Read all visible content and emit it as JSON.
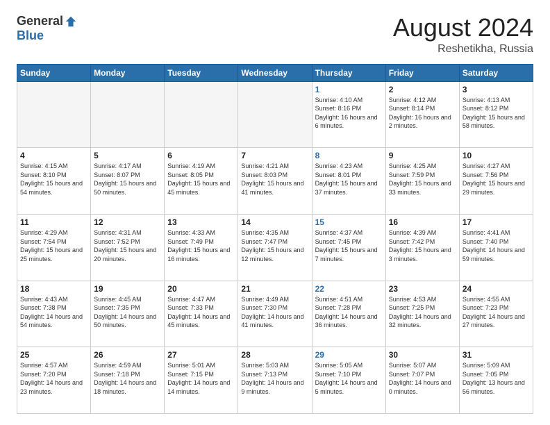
{
  "logo": {
    "general": "General",
    "blue": "Blue"
  },
  "title": "August 2024",
  "location": "Reshetikha, Russia",
  "weekdays": [
    "Sunday",
    "Monday",
    "Tuesday",
    "Wednesday",
    "Thursday",
    "Friday",
    "Saturday"
  ],
  "weeks": [
    [
      {
        "day": "",
        "empty": true
      },
      {
        "day": "",
        "empty": true
      },
      {
        "day": "",
        "empty": true
      },
      {
        "day": "",
        "empty": true
      },
      {
        "day": "1",
        "sunrise": "4:10 AM",
        "sunset": "8:16 PM",
        "daylight": "16 hours and 6 minutes."
      },
      {
        "day": "2",
        "sunrise": "4:12 AM",
        "sunset": "8:14 PM",
        "daylight": "16 hours and 2 minutes."
      },
      {
        "day": "3",
        "sunrise": "4:13 AM",
        "sunset": "8:12 PM",
        "daylight": "15 hours and 58 minutes."
      }
    ],
    [
      {
        "day": "4",
        "sunrise": "4:15 AM",
        "sunset": "8:10 PM",
        "daylight": "15 hours and 54 minutes."
      },
      {
        "day": "5",
        "sunrise": "4:17 AM",
        "sunset": "8:07 PM",
        "daylight": "15 hours and 50 minutes."
      },
      {
        "day": "6",
        "sunrise": "4:19 AM",
        "sunset": "8:05 PM",
        "daylight": "15 hours and 45 minutes."
      },
      {
        "day": "7",
        "sunrise": "4:21 AM",
        "sunset": "8:03 PM",
        "daylight": "15 hours and 41 minutes."
      },
      {
        "day": "8",
        "sunrise": "4:23 AM",
        "sunset": "8:01 PM",
        "daylight": "15 hours and 37 minutes."
      },
      {
        "day": "9",
        "sunrise": "4:25 AM",
        "sunset": "7:59 PM",
        "daylight": "15 hours and 33 minutes."
      },
      {
        "day": "10",
        "sunrise": "4:27 AM",
        "sunset": "7:56 PM",
        "daylight": "15 hours and 29 minutes."
      }
    ],
    [
      {
        "day": "11",
        "sunrise": "4:29 AM",
        "sunset": "7:54 PM",
        "daylight": "15 hours and 25 minutes."
      },
      {
        "day": "12",
        "sunrise": "4:31 AM",
        "sunset": "7:52 PM",
        "daylight": "15 hours and 20 minutes."
      },
      {
        "day": "13",
        "sunrise": "4:33 AM",
        "sunset": "7:49 PM",
        "daylight": "15 hours and 16 minutes."
      },
      {
        "day": "14",
        "sunrise": "4:35 AM",
        "sunset": "7:47 PM",
        "daylight": "15 hours and 12 minutes."
      },
      {
        "day": "15",
        "sunrise": "4:37 AM",
        "sunset": "7:45 PM",
        "daylight": "15 hours and 7 minutes."
      },
      {
        "day": "16",
        "sunrise": "4:39 AM",
        "sunset": "7:42 PM",
        "daylight": "15 hours and 3 minutes."
      },
      {
        "day": "17",
        "sunrise": "4:41 AM",
        "sunset": "7:40 PM",
        "daylight": "14 hours and 59 minutes."
      }
    ],
    [
      {
        "day": "18",
        "sunrise": "4:43 AM",
        "sunset": "7:38 PM",
        "daylight": "14 hours and 54 minutes."
      },
      {
        "day": "19",
        "sunrise": "4:45 AM",
        "sunset": "7:35 PM",
        "daylight": "14 hours and 50 minutes."
      },
      {
        "day": "20",
        "sunrise": "4:47 AM",
        "sunset": "7:33 PM",
        "daylight": "14 hours and 45 minutes."
      },
      {
        "day": "21",
        "sunrise": "4:49 AM",
        "sunset": "7:30 PM",
        "daylight": "14 hours and 41 minutes."
      },
      {
        "day": "22",
        "sunrise": "4:51 AM",
        "sunset": "7:28 PM",
        "daylight": "14 hours and 36 minutes."
      },
      {
        "day": "23",
        "sunrise": "4:53 AM",
        "sunset": "7:25 PM",
        "daylight": "14 hours and 32 minutes."
      },
      {
        "day": "24",
        "sunrise": "4:55 AM",
        "sunset": "7:23 PM",
        "daylight": "14 hours and 27 minutes."
      }
    ],
    [
      {
        "day": "25",
        "sunrise": "4:57 AM",
        "sunset": "7:20 PM",
        "daylight": "14 hours and 23 minutes."
      },
      {
        "day": "26",
        "sunrise": "4:59 AM",
        "sunset": "7:18 PM",
        "daylight": "14 hours and 18 minutes."
      },
      {
        "day": "27",
        "sunrise": "5:01 AM",
        "sunset": "7:15 PM",
        "daylight": "14 hours and 14 minutes."
      },
      {
        "day": "28",
        "sunrise": "5:03 AM",
        "sunset": "7:13 PM",
        "daylight": "14 hours and 9 minutes."
      },
      {
        "day": "29",
        "sunrise": "5:05 AM",
        "sunset": "7:10 PM",
        "daylight": "14 hours and 5 minutes."
      },
      {
        "day": "30",
        "sunrise": "5:07 AM",
        "sunset": "7:07 PM",
        "daylight": "14 hours and 0 minutes."
      },
      {
        "day": "31",
        "sunrise": "5:09 AM",
        "sunset": "7:05 PM",
        "daylight": "13 hours and 56 minutes."
      }
    ]
  ],
  "labels": {
    "sunrise": "Sunrise: ",
    "sunset": "Sunset: ",
    "daylight": "Daylight: "
  }
}
